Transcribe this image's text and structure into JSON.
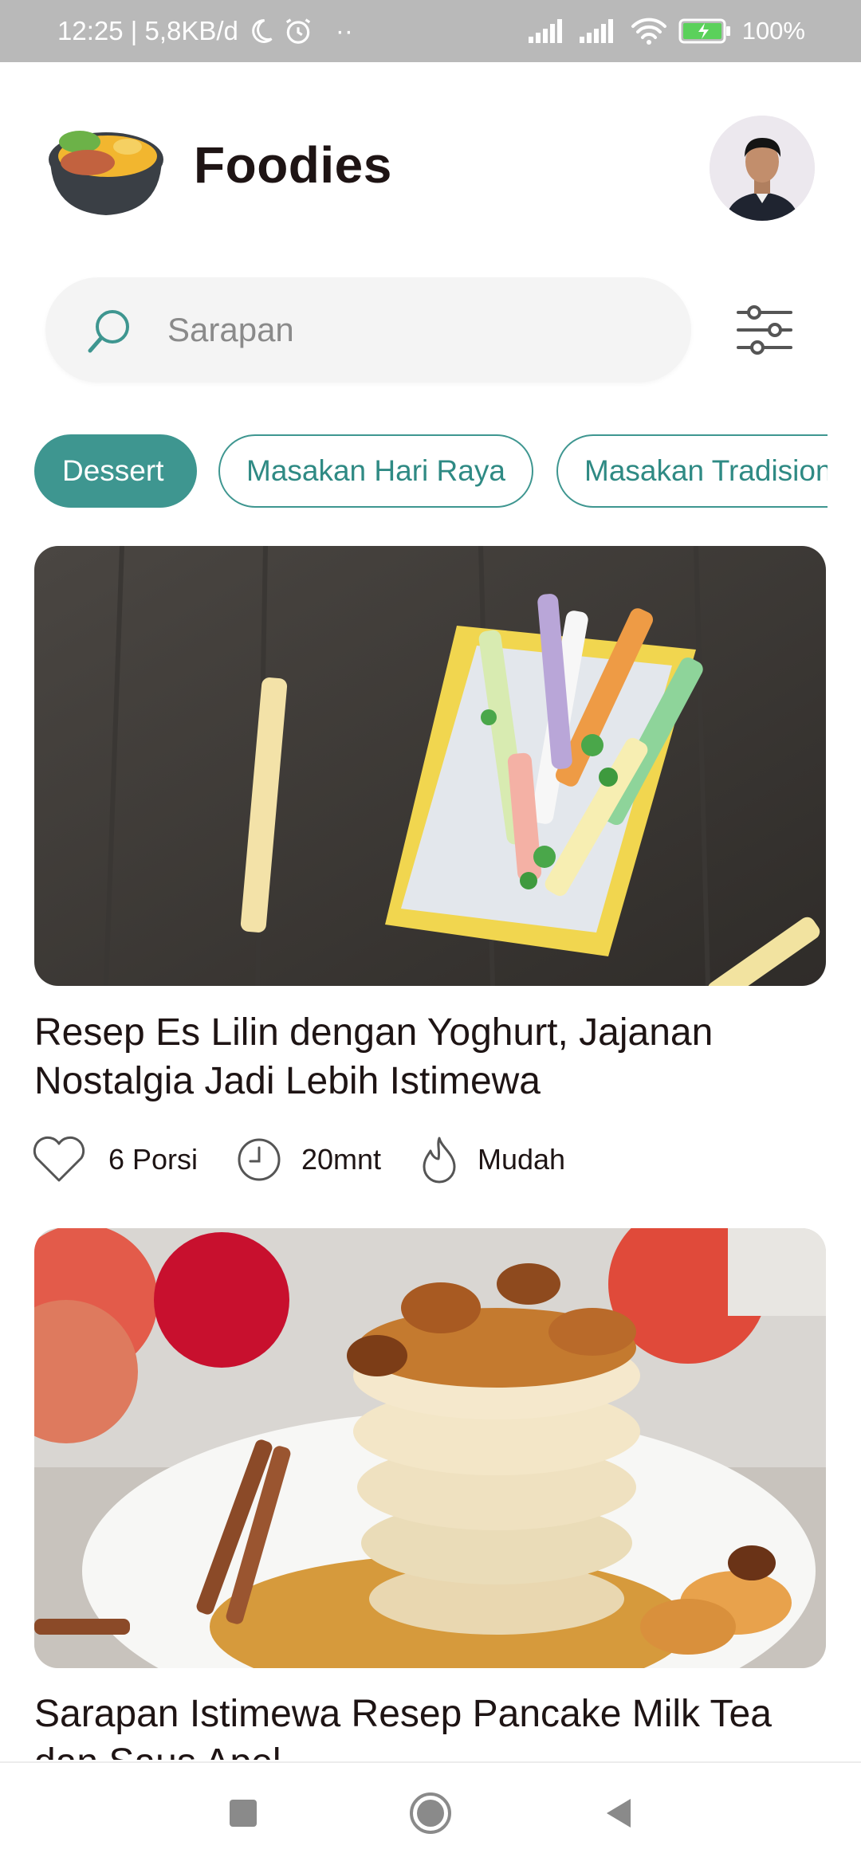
{
  "status_bar": {
    "time_info": "12:25 | 5,8KB/d",
    "dots": "··",
    "battery": "100%"
  },
  "header": {
    "title": "Foodies"
  },
  "search": {
    "placeholder": "Sarapan"
  },
  "categories": [
    {
      "label": "Dessert",
      "active": true
    },
    {
      "label": "Masakan Hari Raya",
      "active": false
    },
    {
      "label": "Masakan Tradisional",
      "active": false
    }
  ],
  "recipes": [
    {
      "title": "Resep Es Lilin dengan Yoghurt, Jajanan Nostalgia Jadi Lebih Istimewa",
      "portion": "6 Porsi",
      "time": "20mnt",
      "difficulty": "Mudah"
    },
    {
      "title": "Sarapan Istimewa Resep Pancake Milk Tea dan Saus Apel"
    }
  ],
  "colors": {
    "accent": "#3e9690",
    "status_bar": "#b9b9b9",
    "search_bg": "#f4f4f4"
  },
  "icons": {
    "search": "search-icon",
    "filter": "filter-icon",
    "portion": "heart-icon",
    "time": "clock-icon",
    "difficulty": "flame-icon"
  }
}
